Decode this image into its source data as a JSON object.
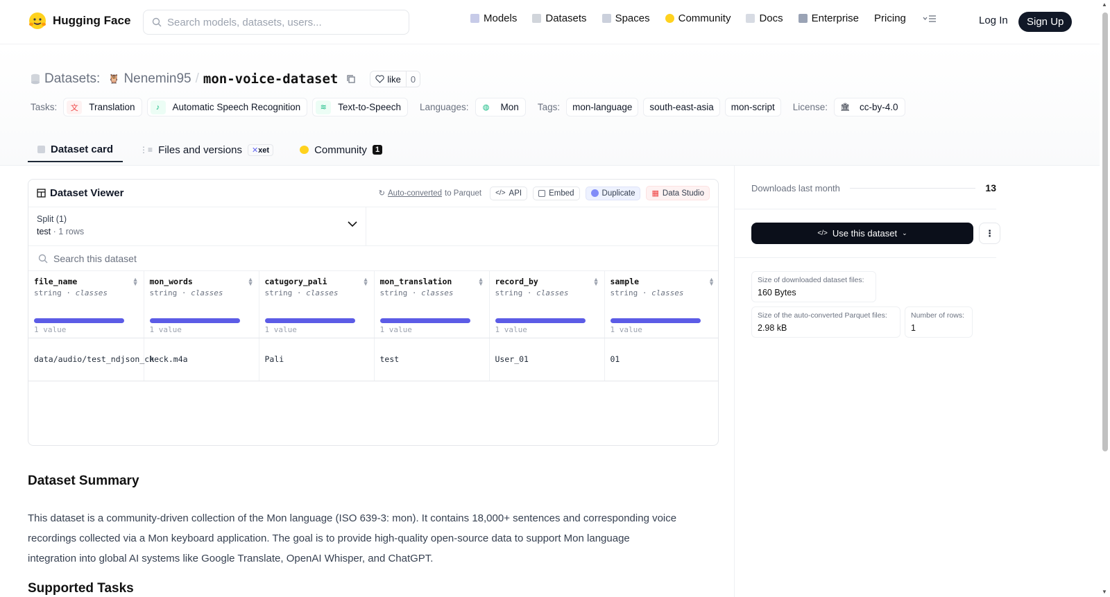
{
  "nav": {
    "brand": "Hugging Face",
    "search_placeholder": "Search models, datasets, users...",
    "links": [
      "Models",
      "Datasets",
      "Spaces",
      "Community",
      "Docs",
      "Enterprise",
      "Pricing"
    ],
    "login": "Log In",
    "signup": "Sign Up"
  },
  "header": {
    "section": "Datasets:",
    "owner": "Nenemin95",
    "slash": "/",
    "repo": "mon-voice-dataset",
    "like_label": "like",
    "like_count": "0",
    "tasks_label": "Tasks:",
    "tasks": [
      "Translation",
      "Automatic Speech Recognition",
      "Text-to-Speech"
    ],
    "languages_label": "Languages:",
    "language": "Mon",
    "tags_label": "Tags:",
    "tags": [
      "mon-language",
      "south-east-asia",
      "mon-script"
    ],
    "license_label": "License:",
    "license": "cc-by-4.0"
  },
  "tabs": {
    "dataset_card": "Dataset card",
    "files": "Files and versions",
    "xet": "xet",
    "community": "Community",
    "community_count": "1"
  },
  "viewer": {
    "title": "Dataset Viewer",
    "auto_converted": "Auto-converted",
    "to_parquet": "to Parquet",
    "api": "API",
    "embed": "Embed",
    "duplicate": "Duplicate",
    "data_studio": "Data Studio",
    "split_label": "Split (1)",
    "split_name": "test",
    "split_rows": "1 rows",
    "search_placeholder": "Search this dataset",
    "columns": [
      {
        "name": "file_name",
        "type": "string",
        "kind": "classes",
        "stat": "1 value"
      },
      {
        "name": "mon_words",
        "type": "string",
        "kind": "classes",
        "stat": "1 value"
      },
      {
        "name": "catugory_pali",
        "type": "string",
        "kind": "classes",
        "stat": "1 value"
      },
      {
        "name": "mon_translation",
        "type": "string",
        "kind": "classes",
        "stat": "1 value"
      },
      {
        "name": "record_by",
        "type": "string",
        "kind": "classes",
        "stat": "1 value"
      },
      {
        "name": "sample",
        "type": "string",
        "kind": "classes",
        "stat": "1 value"
      }
    ],
    "row": [
      "data/audio/test_ndjson_check.m4a",
      "k",
      "Pali",
      "test",
      "User_01",
      "01"
    ]
  },
  "summary": {
    "title": "Dataset Summary",
    "text": "This dataset is a community-driven collection of the Mon language (ISO 639-3: mon). It contains 18,000+ sentences and corresponding voice recordings collected via a Mon keyboard application. The goal is to provide high-quality open-source data to support Mon language integration into global AI systems like Google Translate, OpenAI Whisper, and ChatGPT.",
    "next_title": "Supported Tasks"
  },
  "sidebar": {
    "downloads_label": "Downloads last month",
    "downloads": "13",
    "use_dataset": "Use this dataset",
    "size_dl_label": "Size of downloaded dataset files:",
    "size_dl": "160 Bytes",
    "size_parquet_label": "Size of the auto-converted Parquet files:",
    "size_parquet": "2.98 kB",
    "rows_label": "Number of rows:",
    "rows": "1"
  },
  "colors": {
    "accent_bar": "#5c5ce6",
    "signup_bg": "#111827"
  }
}
